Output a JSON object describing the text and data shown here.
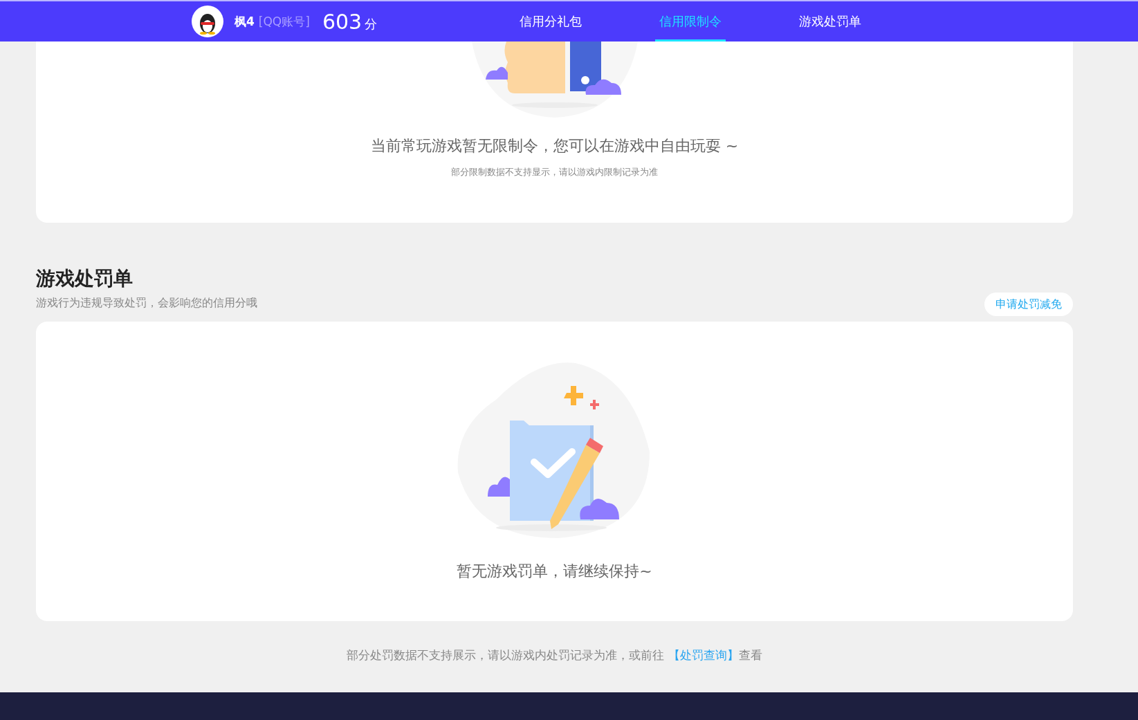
{
  "header": {
    "nickname": "枫4",
    "account_type": "[QQ账号]",
    "score": "603",
    "score_unit": "分",
    "tabs": [
      {
        "label": "信用分礼包",
        "selected": false
      },
      {
        "label": "信用限制令",
        "selected": true
      },
      {
        "label": "游戏处罚单",
        "selected": false
      }
    ]
  },
  "restriction_card": {
    "message": "当前常玩游戏暂无限制令，您可以在游戏中自由玩耍 ~",
    "note": "部分限制数据不支持显示，请以游戏内限制记录为准"
  },
  "penalty_section": {
    "title": "游戏处罚单",
    "subtitle": "游戏行为违规导致处罚，会影响您的信用分哦",
    "action_button": "申请处罚减免",
    "empty_message": "暂无游戏罚单，请继续保持~",
    "footer_note": {
      "before": "部分处罚数据不支持展示，请以游戏内处罚记录为准，或前往 ",
      "link": "【处罚查询】",
      "after": "查看"
    }
  }
}
